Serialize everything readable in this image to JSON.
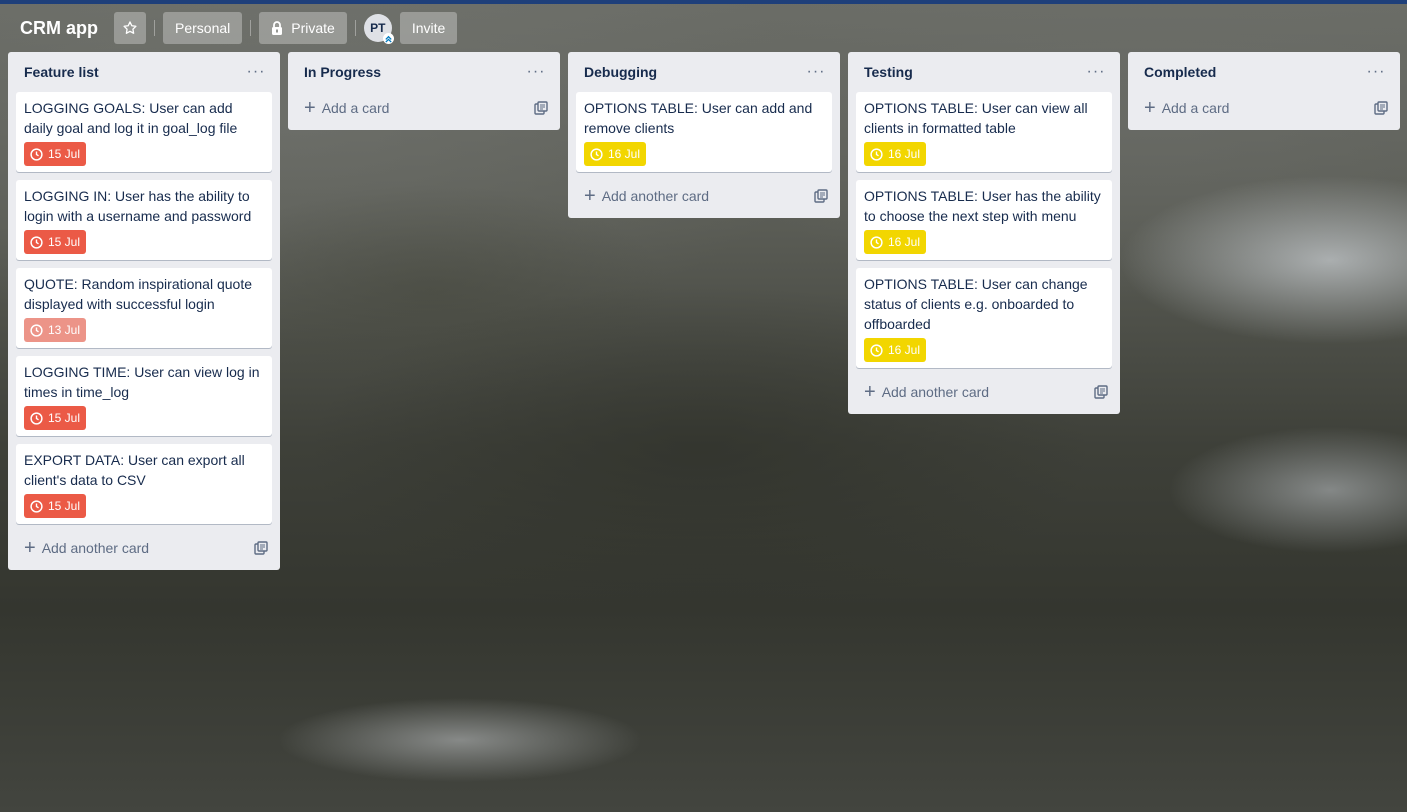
{
  "header": {
    "title": "CRM app",
    "personal_label": "Personal",
    "private_label": "Private",
    "avatar_initials": "PT",
    "invite_label": "Invite"
  },
  "lists": [
    {
      "title": "Feature list",
      "add_label": "Add another card",
      "cards": [
        {
          "text": "LOGGING GOALS: User can add daily goal and log it in goal_log file",
          "due": "15 Jul",
          "due_color": "#eb5a46"
        },
        {
          "text": "LOGGING IN: User has the ability to login with a username and password",
          "due": "15 Jul",
          "due_color": "#eb5a46"
        },
        {
          "text": "QUOTE: Random inspirational quote displayed with successful login",
          "due": "13 Jul",
          "due_color": "#ec9488"
        },
        {
          "text": "LOGGING TIME: User can view log in times in time_log",
          "due": "15 Jul",
          "due_color": "#eb5a46"
        },
        {
          "text": "EXPORT DATA: User can export all client's data to CSV",
          "due": "15 Jul",
          "due_color": "#eb5a46"
        }
      ]
    },
    {
      "title": "In Progress",
      "add_label": "Add a card",
      "cards": []
    },
    {
      "title": "Debugging",
      "add_label": "Add another card",
      "cards": [
        {
          "text": "OPTIONS TABLE: User can add and remove clients",
          "due": "16 Jul",
          "due_color": "#f2d600"
        }
      ]
    },
    {
      "title": "Testing",
      "add_label": "Add another card",
      "cards": [
        {
          "text": "OPTIONS TABLE: User can view all clients in formatted table",
          "due": "16 Jul",
          "due_color": "#f2d600"
        },
        {
          "text": "OPTIONS TABLE: User has the ability to choose the next step with menu",
          "due": "16 Jul",
          "due_color": "#f2d600"
        },
        {
          "text": "OPTIONS TABLE: User can change status of clients e.g. onboarded to offboarded",
          "due": "16 Jul",
          "due_color": "#f2d600"
        }
      ]
    },
    {
      "title": "Completed",
      "add_label": "Add a card",
      "cards": []
    }
  ]
}
